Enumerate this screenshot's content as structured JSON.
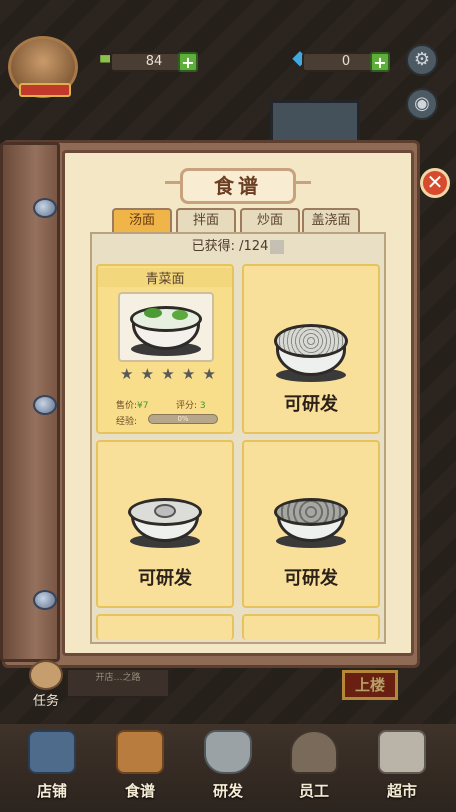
{
  "topbar": {
    "resource1_value": "84",
    "resource2_value": "0",
    "plus": "+",
    "settings_icon": "gear-icon",
    "camera_icon": "camera-icon"
  },
  "book": {
    "title": "食谱",
    "close_label": "✕",
    "tabs": [
      {
        "label": "汤面",
        "active": true
      },
      {
        "label": "拌面",
        "active": false
      },
      {
        "label": "炒面",
        "active": false
      },
      {
        "label": "盖浇面",
        "active": false
      }
    ],
    "obtained_label": "已获得:",
    "obtained_value": "/124"
  },
  "recipes": [
    {
      "name": "青菜面",
      "price_label": "售价:",
      "price_value": "¥7",
      "rating_label": "评分:",
      "rating_value": "3",
      "exp_label": "经验:",
      "exp_value": "0%",
      "exp_fraction": 0,
      "stars": [
        "★",
        "★",
        "★",
        "★",
        "★"
      ]
    },
    {
      "status": "可研发"
    },
    {
      "status": "可研发"
    },
    {
      "status": "可研发"
    }
  ],
  "scene": {
    "sign_text": "上楼",
    "task_label": "任务",
    "quest_text": "开店…之路"
  },
  "nav": [
    {
      "label": "店铺",
      "icon": "store-icon",
      "color": "#4f6b8c"
    },
    {
      "label": "食谱",
      "icon": "recipe-book-icon",
      "color": "#b87c3f"
    },
    {
      "label": "研发",
      "icon": "pot-icon",
      "color": "#9aa2a6"
    },
    {
      "label": "员工",
      "icon": "staff-icon",
      "color": "#7a6a5a"
    },
    {
      "label": "超市",
      "icon": "supermarket-icon",
      "color": "#b9b3a8"
    }
  ]
}
